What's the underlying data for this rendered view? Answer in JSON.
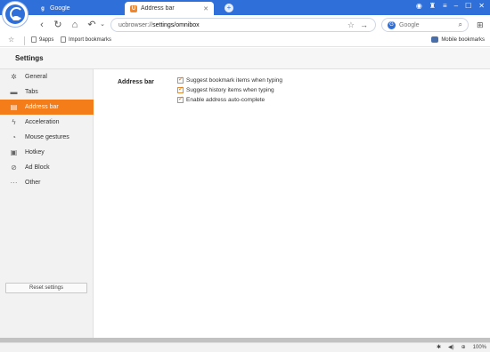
{
  "tabs": [
    {
      "label": "Google",
      "icon": "google-icon"
    },
    {
      "label": "Address bar",
      "icon": "uc-icon"
    }
  ],
  "navbar": {
    "url_prefix": "ucbrowser://",
    "url_path": "settings/omnibox",
    "search_placeholder": "Google"
  },
  "bookmarks": {
    "apps_label": "9apps",
    "import_label": "Import bookmarks",
    "mobile_label": "Mobile bookmarks"
  },
  "settings": {
    "title": "Settings",
    "nav": [
      {
        "label": "General",
        "icon": "gear-icon"
      },
      {
        "label": "Tabs",
        "icon": "tabs-icon"
      },
      {
        "label": "Address bar",
        "icon": "address-bar-icon"
      },
      {
        "label": "Acceleration",
        "icon": "lightning-icon"
      },
      {
        "label": "Mouse gestures",
        "icon": "mouse-gesture-icon"
      },
      {
        "label": "Hotkey",
        "icon": "keyboard-icon"
      },
      {
        "label": "Ad Block",
        "icon": "block-icon"
      },
      {
        "label": "Other",
        "icon": "more-icon"
      }
    ],
    "active_index": 2,
    "reset_label": "Reset settings",
    "section": {
      "label": "Address bar",
      "options": [
        {
          "label": "Suggest bookmark items when typing",
          "checked": true
        },
        {
          "label": "Suggest history items when typing",
          "checked": true
        },
        {
          "label": "Enable address auto-complete",
          "checked": true
        }
      ]
    }
  },
  "status": {
    "zoom": "100%"
  },
  "colors": {
    "accent": "#f57d19",
    "titlebar": "#2f6fd9"
  }
}
